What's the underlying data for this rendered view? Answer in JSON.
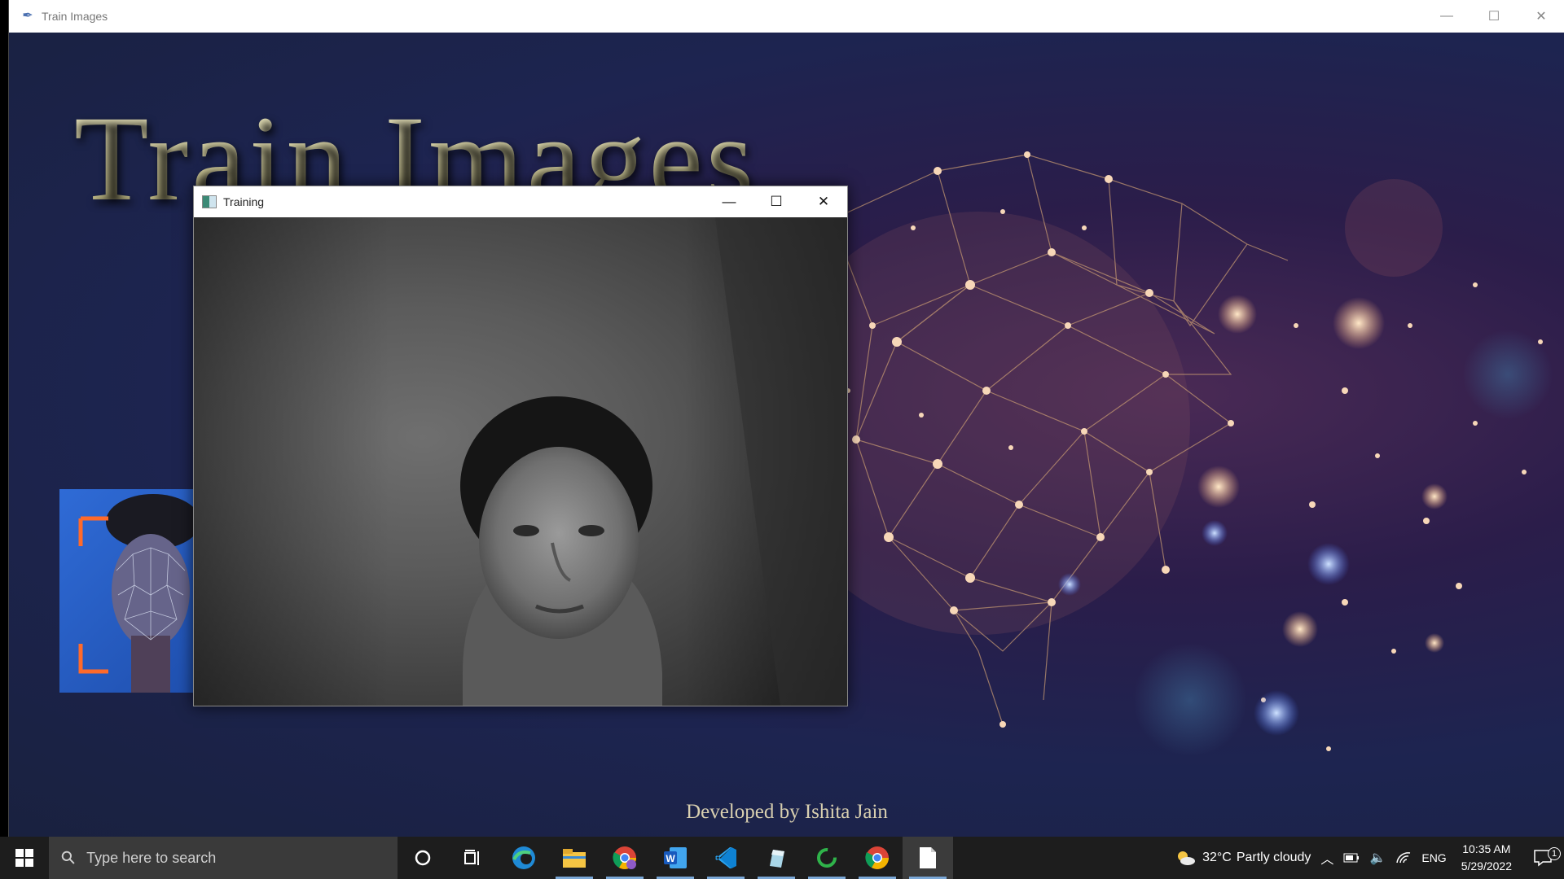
{
  "app_window": {
    "title": "Train Images",
    "heading": "Train Images",
    "credit": "Developed by Ishita Jain"
  },
  "training_window": {
    "title": "Training"
  },
  "taskbar": {
    "search_placeholder": "Type here to search",
    "pinned_apps": [
      "cortana-icon",
      "task-view-icon",
      "edge-icon",
      "file-explorer-icon",
      "chrome-icon",
      "word-icon",
      "vscode-icon",
      "pen-app-icon",
      "loading-app-icon",
      "chrome-icon",
      "file-icon"
    ],
    "weather": {
      "temperature": "32°C",
      "condition": "Partly cloudy"
    },
    "language": "ENG",
    "time": "10:35 AM",
    "date": "5/29/2022",
    "notification_count": "1"
  },
  "colors": {
    "background_dark": "#1d2450",
    "heading_gold": "#d8d0a0",
    "taskbar": "#1d1d1d",
    "face_panel_blue": "#2f6bd6"
  }
}
